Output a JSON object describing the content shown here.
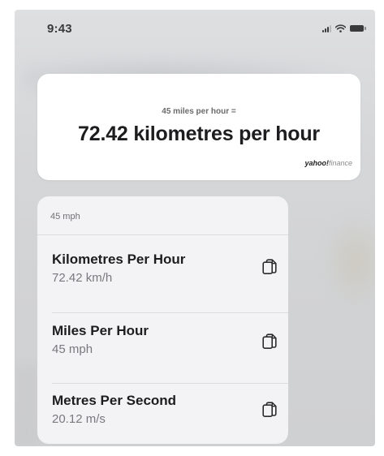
{
  "status_bar": {
    "time": "9:43"
  },
  "answer_card": {
    "query": "45 miles per hour =",
    "result": "72.42 kilometres per hour",
    "source_brand": "yahoo!",
    "source_suffix": "finance"
  },
  "conversions": {
    "input": "45 mph",
    "rows": [
      {
        "title": "Kilometres Per Hour",
        "value": "72.42 km/h"
      },
      {
        "title": "Miles Per Hour",
        "value": "45 mph"
      },
      {
        "title": "Metres Per Second",
        "value": "20.12 m/s"
      }
    ]
  },
  "icons": {
    "copy": "copy-icon",
    "signal": "cellular-signal-icon",
    "wifi": "wifi-icon",
    "battery": "battery-icon"
  },
  "colors": {
    "text_primary": "#1d1d1f",
    "text_secondary": "#7a7a7e",
    "card_background": "#ffffff",
    "list_background": "#f4f4f6"
  }
}
